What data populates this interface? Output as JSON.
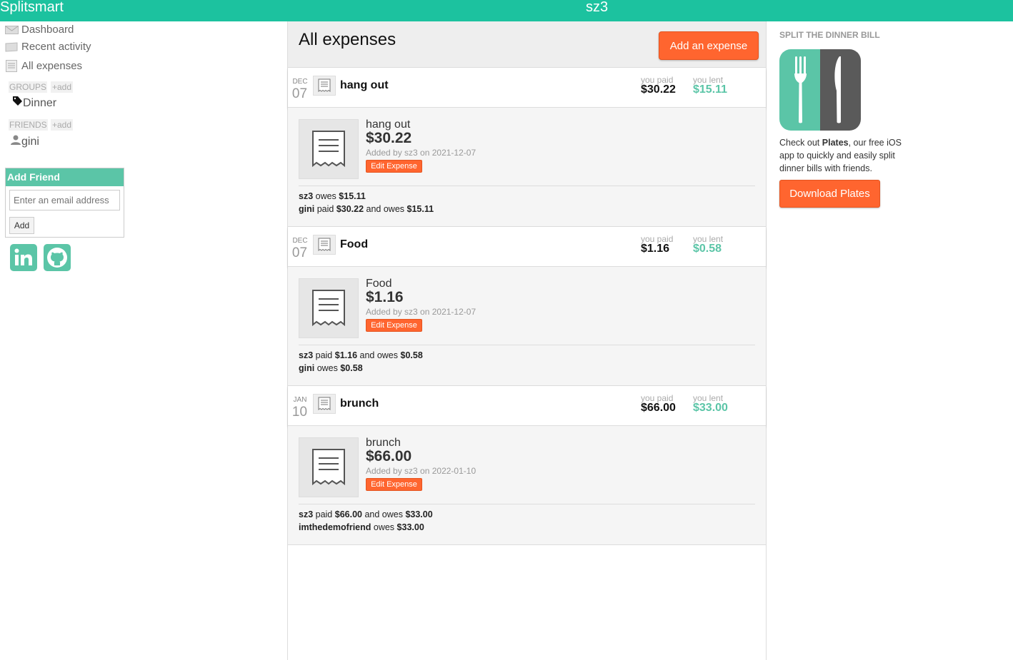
{
  "app": {
    "brand": "Splitsmart",
    "user": "sz3"
  },
  "sidebar": {
    "nav": [
      {
        "label": "Dashboard",
        "icon": "envelope-icon"
      },
      {
        "label": "Recent activity",
        "icon": "flag-icon"
      },
      {
        "label": "All expenses",
        "icon": "list-icon"
      }
    ],
    "groups_header": "GROUPS",
    "groups_add": "+add",
    "groups": [
      {
        "label": "Dinner",
        "icon": "tag-icon"
      }
    ],
    "friends_header": "FRIENDS",
    "friends_add": "+add",
    "friends": [
      {
        "label": "gini",
        "icon": "person-icon"
      }
    ],
    "add_friend": {
      "title": "Add Friend",
      "placeholder": "Enter an email address",
      "button": "Add"
    },
    "social": [
      {
        "icon": "linkedin-icon"
      },
      {
        "icon": "github-icon"
      }
    ]
  },
  "main": {
    "title": "All expenses",
    "add_button": "Add an expense",
    "expenses": [
      {
        "month": "DEC",
        "day": "07",
        "description": "hang out",
        "paid_label": "you paid",
        "paid": "$30.22",
        "lent_label": "you lent",
        "lent": "$15.11",
        "detail": {
          "name": "hang out",
          "amount": "$30.22",
          "added": "Added by sz3 on 2021-12-07",
          "edit": "Edit Expense",
          "lines": [
            [
              {
                "t": "sz3",
                "b": true
              },
              {
                "t": " owes "
              },
              {
                "t": "$15.11",
                "b": true
              }
            ],
            [
              {
                "t": "gini",
                "b": true
              },
              {
                "t": " paid "
              },
              {
                "t": "$30.22",
                "b": true
              },
              {
                "t": " and owes "
              },
              {
                "t": "$15.11",
                "b": true
              }
            ]
          ]
        }
      },
      {
        "month": "DEC",
        "day": "07",
        "description": "Food",
        "paid_label": "you paid",
        "paid": "$1.16",
        "lent_label": "you lent",
        "lent": "$0.58",
        "detail": {
          "name": "Food",
          "amount": "$1.16",
          "added": "Added by sz3 on 2021-12-07",
          "edit": "Edit Expense",
          "lines": [
            [
              {
                "t": "sz3",
                "b": true
              },
              {
                "t": " paid "
              },
              {
                "t": "$1.16",
                "b": true
              },
              {
                "t": " and owes "
              },
              {
                "t": "$0.58",
                "b": true
              }
            ],
            [
              {
                "t": "gini",
                "b": true
              },
              {
                "t": " owes "
              },
              {
                "t": "$0.58",
                "b": true
              }
            ]
          ]
        }
      },
      {
        "month": "JAN",
        "day": "10",
        "description": "brunch",
        "paid_label": "you paid",
        "paid": "$66.00",
        "lent_label": "you lent",
        "lent": "$33.00",
        "detail": {
          "name": "brunch",
          "amount": "$66.00",
          "added": "Added by sz3 on 2022-01-10",
          "edit": "Edit Expense",
          "lines": [
            [
              {
                "t": "sz3",
                "b": true
              },
              {
                "t": " paid "
              },
              {
                "t": "$66.00",
                "b": true
              },
              {
                "t": " and owes "
              },
              {
                "t": "$33.00",
                "b": true
              }
            ],
            [
              {
                "t": "imthedemofriend",
                "b": true
              },
              {
                "t": " owes "
              },
              {
                "t": "$33.00",
                "b": true
              }
            ]
          ]
        }
      }
    ]
  },
  "right": {
    "header": "SPLIT THE DINNER BILL",
    "text_before": "Check out ",
    "text_bold": "Plates",
    "text_after": ", our free iOS app to quickly and easily split dinner bills with friends.",
    "button": "Download Plates",
    "colors": {
      "left_half": "#5bc5a7",
      "right_half": "#5a5a5a"
    }
  },
  "colors": {
    "brand": "#1cc29f",
    "accent": "#ff652f",
    "lent": "#5bc5a7"
  }
}
